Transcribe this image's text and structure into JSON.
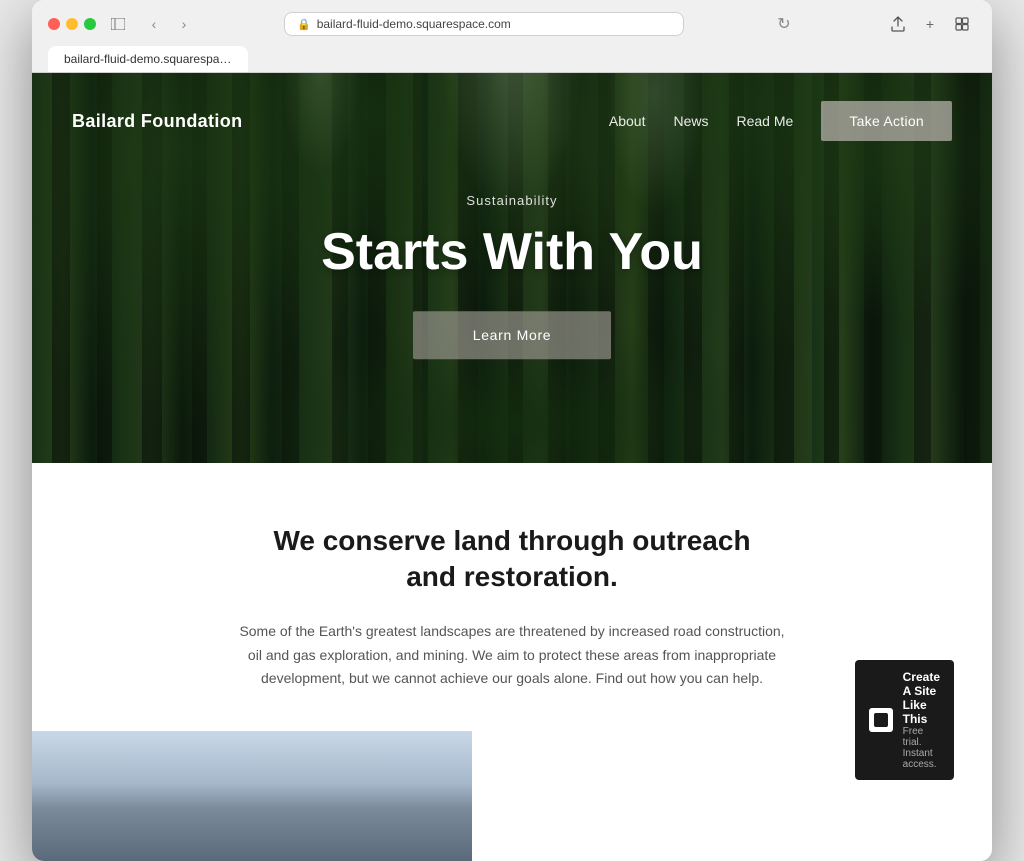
{
  "browser": {
    "url": "bailard-fluid-demo.squarespace.com",
    "tab_title": "bailard-fluid-demo.squarespace.com"
  },
  "site": {
    "logo": "Bailard Foundation",
    "nav": {
      "links": [
        "About",
        "News",
        "Read Me"
      ],
      "cta_label": "Take Action"
    },
    "hero": {
      "eyebrow": "Sustainability",
      "title": "Starts With You",
      "cta_label": "Learn More"
    },
    "content": {
      "headline": "We conserve land through outreach and restoration.",
      "body": "Some of the Earth's greatest landscapes are threatened by increased road construction, oil and gas exploration, and mining. We aim to protect these areas from inappropriate development, but we cannot achieve our goals alone. Find out how you can help."
    },
    "badge": {
      "title": "Create A Site Like This",
      "subtitle": "Free trial. Instant access."
    }
  }
}
